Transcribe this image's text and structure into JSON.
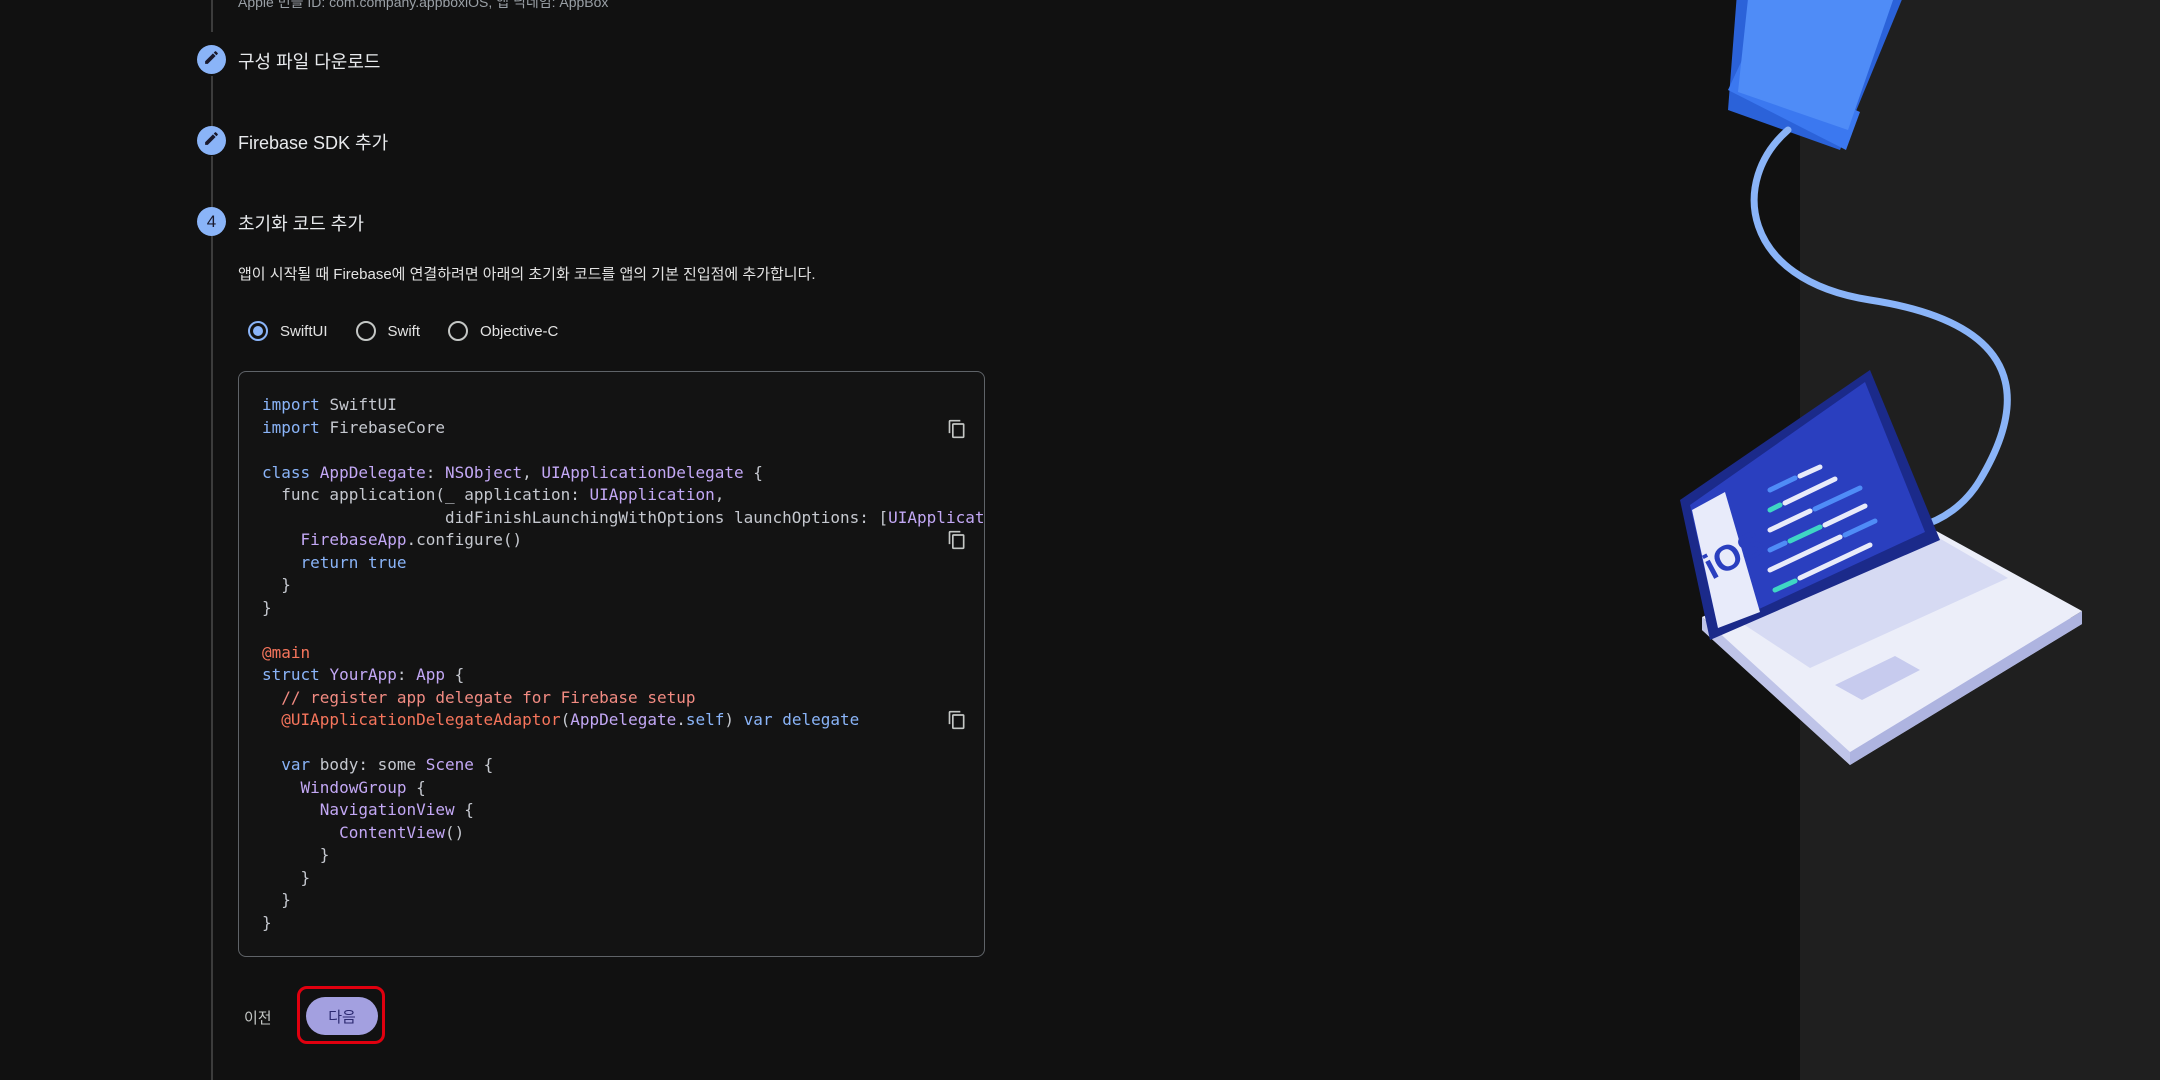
{
  "header": {
    "bundle_info": "Apple 번들 ID: com.company.appboxiOS, 앱 닉네임: AppBox"
  },
  "steps": [
    {
      "number": "",
      "title": "구성 파일 다운로드",
      "icon": "pencil-icon"
    },
    {
      "number": "",
      "title": "Firebase SDK 추가",
      "icon": "pencil-icon"
    },
    {
      "number": "4",
      "title": "초기화 코드 추가"
    }
  ],
  "step4": {
    "description": "앱이 시작될 때 Firebase에 연결하려면 아래의 초기화 코드를 앱의 기본 진입점에 추가합니다.",
    "language_options": [
      {
        "label": "SwiftUI",
        "selected": true
      },
      {
        "label": "Swift",
        "selected": false
      },
      {
        "label": "Objective-C",
        "selected": false
      }
    ]
  },
  "code": {
    "lines": [
      [
        {
          "t": "import ",
          "c": "kw"
        },
        {
          "t": "SwiftUI",
          "c": "pl"
        }
      ],
      [
        {
          "t": "import ",
          "c": "kw"
        },
        {
          "t": "FirebaseCore",
          "c": "pl"
        }
      ],
      [],
      [
        {
          "t": "class ",
          "c": "kw"
        },
        {
          "t": "AppDelegate",
          "c": "ty"
        },
        {
          "t": ": ",
          "c": "pl"
        },
        {
          "t": "NSObject",
          "c": "ty"
        },
        {
          "t": ", ",
          "c": "pl"
        },
        {
          "t": "UIApplicationDelegate",
          "c": "ty"
        },
        {
          "t": " {",
          "c": "pl"
        }
      ],
      [
        {
          "t": "  func application(_ application: ",
          "c": "pl"
        },
        {
          "t": "UIApplication",
          "c": "ty"
        },
        {
          "t": ",",
          "c": "pl"
        }
      ],
      [
        {
          "t": "                   didFinishLaunchingWithOptions launchOptions: [",
          "c": "pl"
        },
        {
          "t": "UIApplicationLaunchOptionsKey",
          "c": "ty"
        }
      ],
      [
        {
          "t": "    ",
          "c": "pl"
        },
        {
          "t": "FirebaseApp",
          "c": "ty"
        },
        {
          "t": ".configure()",
          "c": "pl"
        }
      ],
      [
        {
          "t": "    ",
          "c": "pl"
        },
        {
          "t": "return true",
          "c": "kw"
        }
      ],
      [
        {
          "t": "  }",
          "c": "pl"
        }
      ],
      [
        {
          "t": "}",
          "c": "pl"
        }
      ],
      [],
      [
        {
          "t": "@main",
          "c": "at"
        }
      ],
      [
        {
          "t": "struct ",
          "c": "kw"
        },
        {
          "t": "YourApp",
          "c": "ty"
        },
        {
          "t": ": ",
          "c": "pl"
        },
        {
          "t": "App",
          "c": "ty"
        },
        {
          "t": " {",
          "c": "pl"
        }
      ],
      [
        {
          "t": "  // register app delegate for Firebase setup",
          "c": "cm"
        }
      ],
      [
        {
          "t": "  ",
          "c": "pl"
        },
        {
          "t": "@UIApplicationDelegateAdaptor",
          "c": "at"
        },
        {
          "t": "(",
          "c": "pl"
        },
        {
          "t": "AppDelegate",
          "c": "ty"
        },
        {
          "t": ".",
          "c": "pl"
        },
        {
          "t": "self",
          "c": "kw"
        },
        {
          "t": ") ",
          "c": "pl"
        },
        {
          "t": "var delegate",
          "c": "kw"
        }
      ],
      [],
      [
        {
          "t": "  ",
          "c": "pl"
        },
        {
          "t": "var ",
          "c": "kw"
        },
        {
          "t": "body: some ",
          "c": "pl"
        },
        {
          "t": "Scene",
          "c": "ty"
        },
        {
          "t": " {",
          "c": "pl"
        }
      ],
      [
        {
          "t": "    ",
          "c": "pl"
        },
        {
          "t": "WindowGroup",
          "c": "ty"
        },
        {
          "t": " {",
          "c": "pl"
        }
      ],
      [
        {
          "t": "      ",
          "c": "pl"
        },
        {
          "t": "NavigationView",
          "c": "ty"
        },
        {
          "t": " {",
          "c": "pl"
        }
      ],
      [
        {
          "t": "        ",
          "c": "pl"
        },
        {
          "t": "ContentView",
          "c": "ty"
        },
        {
          "t": "()",
          "c": "pl"
        }
      ],
      [
        {
          "t": "      }",
          "c": "pl"
        }
      ],
      [
        {
          "t": "    }",
          "c": "pl"
        }
      ],
      [
        {
          "t": "  }",
          "c": "pl"
        }
      ],
      [
        {
          "t": "}",
          "c": "pl"
        }
      ]
    ]
  },
  "actions": {
    "prev_label": "이전",
    "next_label": "다음"
  },
  "illustration": {
    "screen_label": "iOS"
  },
  "colors": {
    "accent": "#8ab4f8",
    "next_button": "#a3a0e0",
    "highlight_border": "#e0000f"
  }
}
